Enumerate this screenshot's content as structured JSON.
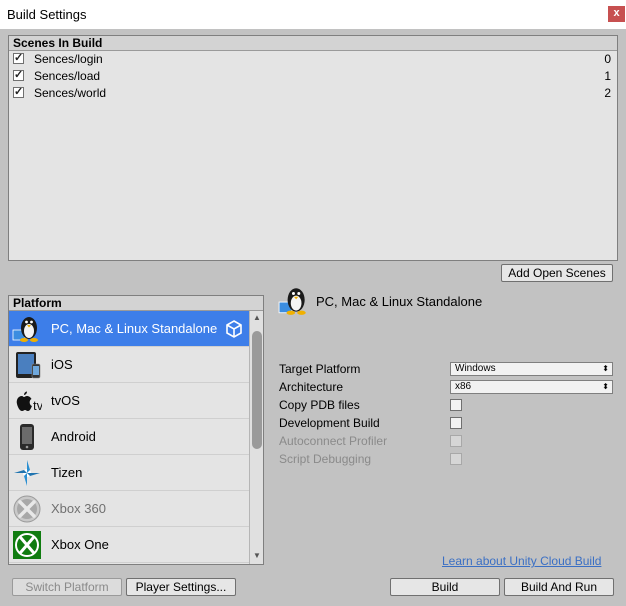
{
  "window": {
    "title": "Build Settings",
    "close_glyph": "x"
  },
  "scenes": {
    "header": "Scenes In Build",
    "items": [
      {
        "checked": true,
        "name": "Sences/login",
        "index": "0"
      },
      {
        "checked": true,
        "name": "Sences/load",
        "index": "1"
      },
      {
        "checked": true,
        "name": "Sences/world",
        "index": "2"
      }
    ],
    "add_open_scenes": "Add Open Scenes"
  },
  "platform": {
    "header": "Platform",
    "items": [
      {
        "label": "PC, Mac & Linux Standalone",
        "icon": "linux-penguin-icon",
        "selected": true,
        "active": true
      },
      {
        "label": "iOS",
        "icon": "ipad-icon"
      },
      {
        "label": "tvOS",
        "icon": "appletv-icon"
      },
      {
        "label": "Android",
        "icon": "android-phone-icon"
      },
      {
        "label": "Tizen",
        "icon": "tizen-icon"
      },
      {
        "label": "Xbox 360",
        "icon": "xbox360-icon",
        "dim": true
      },
      {
        "label": "Xbox One",
        "icon": "xbox-one-icon"
      }
    ]
  },
  "settings": {
    "selected_title": "PC, Mac & Linux Standalone",
    "target_platform_label": "Target Platform",
    "target_platform_value": "Windows",
    "architecture_label": "Architecture",
    "architecture_value": "x86",
    "copy_pdb_label": "Copy PDB files",
    "development_build_label": "Development Build",
    "autoconnect_profiler_label": "Autoconnect Profiler",
    "script_debugging_label": "Script Debugging"
  },
  "footer": {
    "cloud_link": "Learn about Unity Cloud Build",
    "switch_platform": "Switch Platform",
    "player_settings": "Player Settings...",
    "build": "Build",
    "build_and_run": "Build And Run"
  },
  "colors": {
    "selection": "#3d7ee9",
    "window_bg": "#c2c2c2",
    "close_bg": "#c75050",
    "link": "#3a6fc4"
  }
}
